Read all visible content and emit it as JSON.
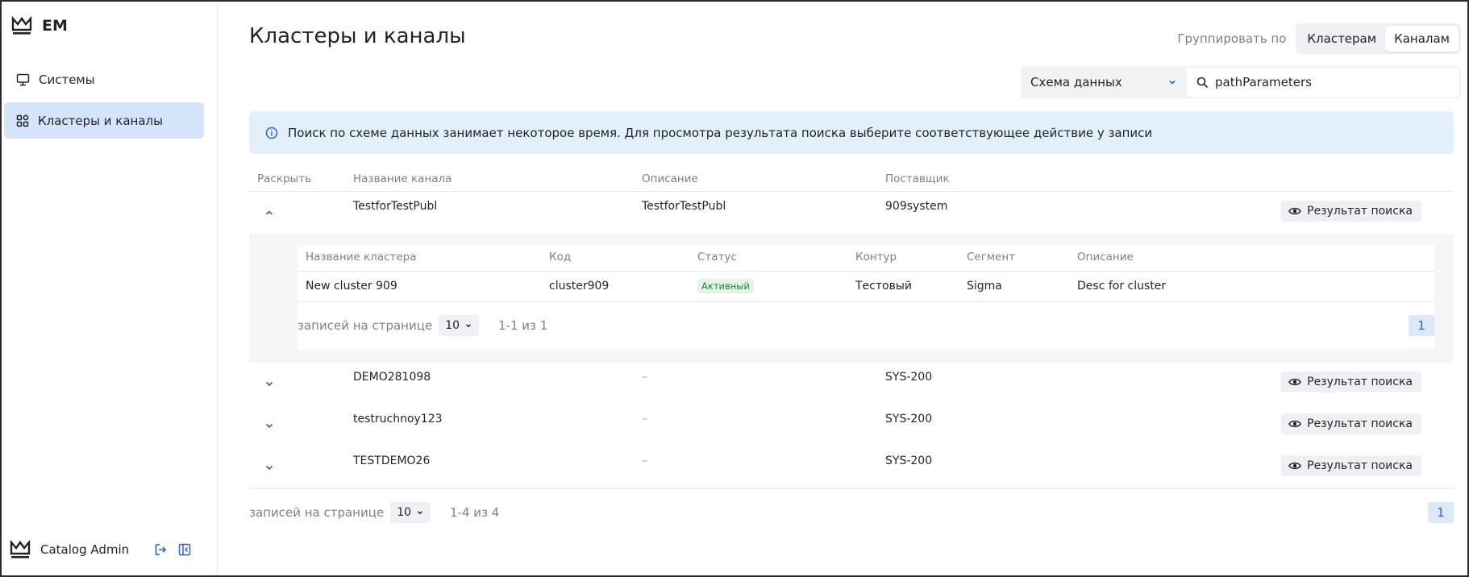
{
  "app": {
    "name": "EM"
  },
  "sidebar": {
    "items": [
      {
        "label": "Системы",
        "icon": "monitor-icon"
      },
      {
        "label": "Кластеры и каналы",
        "icon": "grid-icon",
        "active": true
      }
    ],
    "user": {
      "name": "Catalog Admin"
    }
  },
  "header": {
    "title": "Кластеры и каналы",
    "group_by_label": "Группировать по",
    "group_options": [
      {
        "label": "Кластерам",
        "active": false
      },
      {
        "label": "Каналам",
        "active": true
      }
    ]
  },
  "search": {
    "scope": "Схема данных",
    "value": "pathParameters"
  },
  "info": {
    "text": "Поиск по схеме данных занимает некоторое время. Для просмотра результата поиска выберите соответствующее действие у записи"
  },
  "table": {
    "columns": [
      "Раскрыть",
      "Название канала",
      "Описание",
      "Поставщик"
    ],
    "action_label": "Результат поиска",
    "rows": [
      {
        "name": "TestforTestPubl",
        "description": "TestforTestPubl",
        "supplier": "909system",
        "expanded": true
      },
      {
        "name": "DEMO281098",
        "description": "–",
        "supplier": "SYS-200",
        "expanded": false
      },
      {
        "name": "testruchnoy123",
        "description": "–",
        "supplier": "SYS-200",
        "expanded": false
      },
      {
        "name": "TESTDEMO26",
        "description": "–",
        "supplier": "SYS-200",
        "expanded": false
      }
    ],
    "pagination": {
      "label": "записей на странице",
      "per_page": "10",
      "range": "1-4 из 4",
      "page": "1"
    }
  },
  "inner_table": {
    "columns": [
      "Название кластера",
      "Код",
      "Статус",
      "Контур",
      "Сегмент",
      "Описание"
    ],
    "rows": [
      {
        "name": "New cluster 909",
        "code": "cluster909",
        "status": "Активный",
        "contour": "Тестовый",
        "segment": "Sigma",
        "description": "Desc for cluster"
      }
    ],
    "pagination": {
      "label": "записей на странице",
      "per_page": "10",
      "range": "1-1 из 1",
      "page": "1"
    }
  },
  "colors": {
    "accent": "#2b62c3",
    "active_nav": "#d6e4fb",
    "info_bg": "#e3effb",
    "status_active": "#2f7a43"
  }
}
